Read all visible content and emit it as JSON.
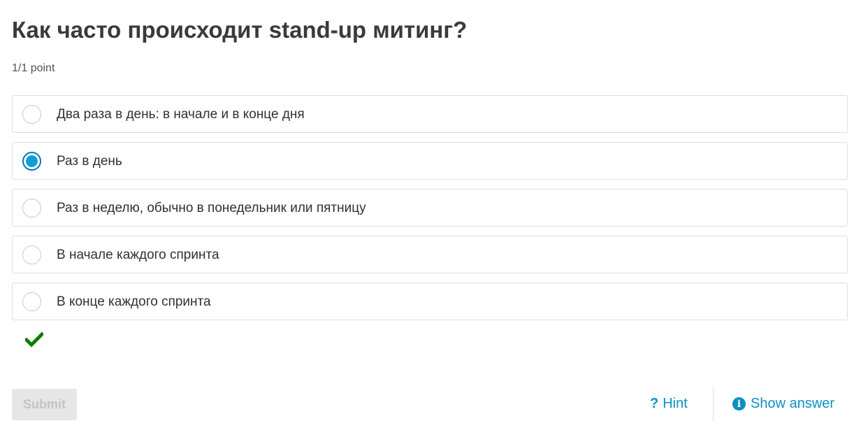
{
  "question": {
    "title": "Как часто происходит stand-up митинг?",
    "points": "1/1 point"
  },
  "options": [
    {
      "label": "Два раза в день: в начале и в конце дня",
      "selected": false
    },
    {
      "label": "Раз в день",
      "selected": true
    },
    {
      "label": "Раз в неделю, обычно в понедельник или пятницу",
      "selected": false
    },
    {
      "label": "В начале каждого спринта",
      "selected": false
    },
    {
      "label": "В конце каждого спринта",
      "selected": false
    }
  ],
  "feedback": {
    "icon": "checkmark-icon",
    "color": "#008000"
  },
  "actions": {
    "submit_label": "Submit",
    "hint_icon": "?",
    "hint_label": "Hint",
    "show_answer_icon": "i",
    "show_answer_label": "Show answer"
  },
  "colors": {
    "accent": "#0c8fc4",
    "radio_fill": "#0f9fd2",
    "correct": "#008000"
  }
}
